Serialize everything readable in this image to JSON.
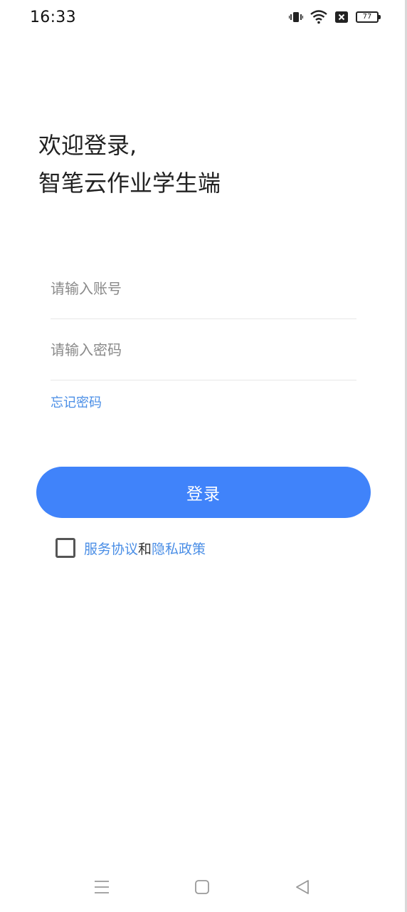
{
  "status_bar": {
    "time": "16:33",
    "battery": "77",
    "icons": [
      "vibrate-icon",
      "wifi-icon",
      "no-sim-icon",
      "battery-icon"
    ]
  },
  "welcome": {
    "line1": "欢迎登录,",
    "line2": "智笔云作业学生端"
  },
  "form": {
    "account_placeholder": "请输入账号",
    "account_value": "",
    "password_placeholder": "请输入密码",
    "password_value": "",
    "forgot_label": "忘记密码",
    "login_label": "登录"
  },
  "agreement": {
    "checked": false,
    "service_label": "服务协议",
    "and_label": "和",
    "privacy_label": "隐私政策"
  },
  "nav": {
    "icons": [
      "menu-icon",
      "home-icon",
      "back-icon"
    ]
  },
  "colors": {
    "accent": "#4083fa",
    "link": "#4a8ee6",
    "background": "#ffffff"
  }
}
